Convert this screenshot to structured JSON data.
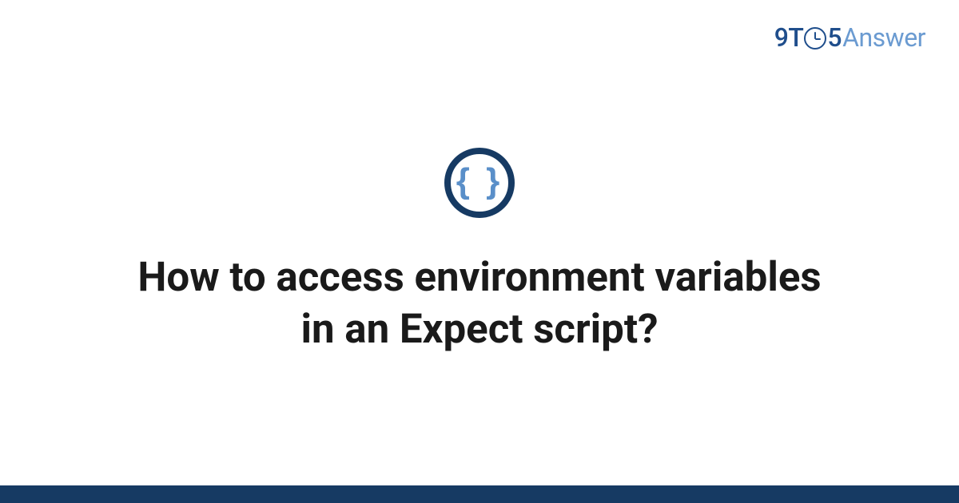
{
  "brand": {
    "nine": "9",
    "t": "T",
    "five": "5",
    "answer": "Answer"
  },
  "icon": {
    "name": "code-braces-icon",
    "glyph": "{ }"
  },
  "title": "How to access environment variables in an Expect script?",
  "colors": {
    "brand_primary": "#1f4e8c",
    "brand_secondary": "#6b9bd1",
    "icon_ring": "#163a63",
    "icon_glyph": "#5a8fc9",
    "footer": "#163a63",
    "text": "#1a1a1a"
  }
}
